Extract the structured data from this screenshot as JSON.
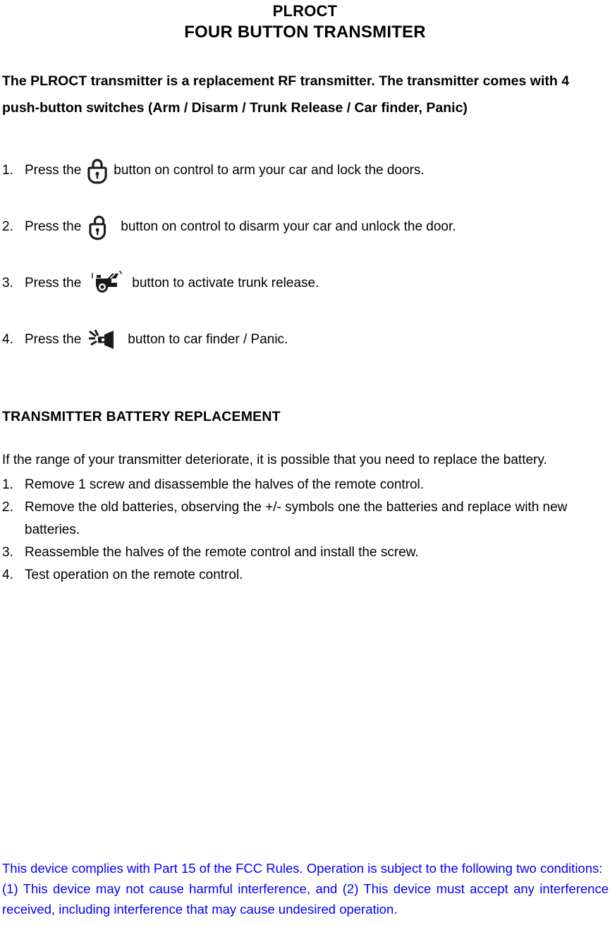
{
  "document": {
    "title_line_1": "PLROCT",
    "title_line_2": "FOUR BUTTON TRANSMITER",
    "intro_paragraph": "The PLROCT transmitter is a replacement RF transmitter. The transmitter comes with 4 push-button switches (Arm /  Disarm /  Trunk Release /  Car finder, Panic)",
    "operation_steps": [
      {
        "number": "1.",
        "text_before": "Press the",
        "icon": "padlock-closed-icon",
        "text_after": "button on control to arm your car and lock the doors."
      },
      {
        "number": "2.",
        "text_before": "Press the",
        "icon": "padlock-open-icon",
        "text_after": "button on control to disarm your car and unlock the door."
      },
      {
        "number": "3.",
        "text_before": "Press the",
        "icon": "car-trunk-open-icon",
        "text_after": "button to activate trunk release."
      },
      {
        "number": "4.",
        "text_before": "Press the",
        "icon": "siren-horn-icon",
        "text_after": "button to car finder / Panic."
      }
    ],
    "battery_section": {
      "heading": "TRANSMITTER BATTERY REPLACEMENT",
      "intro": "If the range of your transmitter deteriorate, it is possible that you need to replace the battery.",
      "steps": [
        {
          "number": "1.",
          "text": "Remove 1 screw and disassemble the halves of the remote control."
        },
        {
          "number": "2.",
          "text": "Remove the old batteries, observing the +/- symbols one the batteries and replace with new batteries."
        },
        {
          "number": "3.",
          "text": "Reassemble the halves of the remote control and install the screw."
        },
        {
          "number": "4.",
          "text": "Test operation on the remote control."
        }
      ]
    },
    "fcc_notice": {
      "color": "#0000FF",
      "line_1": "This device complies with Part 15 of the FCC Rules. Operation is subject to the following two conditions:",
      "line_2": "(1) This device may not cause harmful interference, and (2) This device must accept any interference received, including interference that may cause undesired operation."
    }
  }
}
